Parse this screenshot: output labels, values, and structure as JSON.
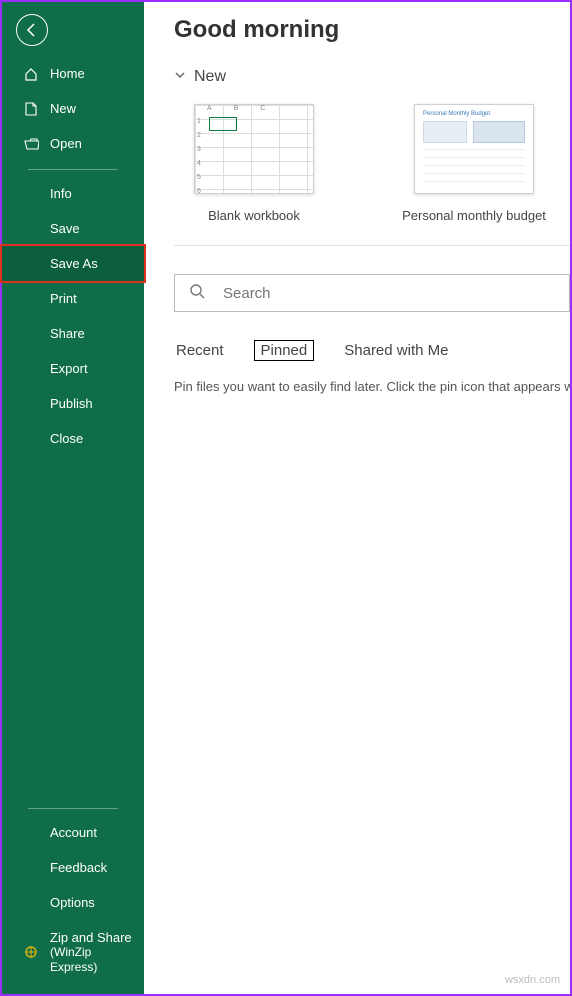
{
  "colors": {
    "brand": "#0f6e47",
    "highlight_border": "#e03020",
    "frame": "#9b2fff"
  },
  "sidebar": {
    "top": [
      {
        "label": "Home",
        "icon": "home"
      },
      {
        "label": "New",
        "icon": "file"
      },
      {
        "label": "Open",
        "icon": "folder"
      }
    ],
    "middle": [
      {
        "label": "Info"
      },
      {
        "label": "Save"
      },
      {
        "label": "Save As",
        "highlighted": true
      },
      {
        "label": "Print"
      },
      {
        "label": "Share"
      },
      {
        "label": "Export"
      },
      {
        "label": "Publish"
      },
      {
        "label": "Close"
      }
    ],
    "bottom": [
      {
        "label": "Account"
      },
      {
        "label": "Feedback"
      },
      {
        "label": "Options"
      }
    ],
    "zipshare": {
      "line1": "Zip and Share",
      "line2": "(WinZip",
      "line3": "Express)"
    }
  },
  "main": {
    "title": "Good morning",
    "section_new": "New",
    "templates": [
      {
        "label": "Blank workbook",
        "kind": "blank"
      },
      {
        "label": "Personal monthly budget",
        "kind": "budget"
      }
    ],
    "search": {
      "placeholder": "Search"
    },
    "tabs": [
      {
        "label": "Recent",
        "active": false
      },
      {
        "label": "Pinned",
        "active": true
      },
      {
        "label": "Shared with Me",
        "active": false
      }
    ],
    "helper_text": "Pin files you want to easily find later. Click the pin icon that appears when"
  },
  "watermark": "wsxdn.com"
}
